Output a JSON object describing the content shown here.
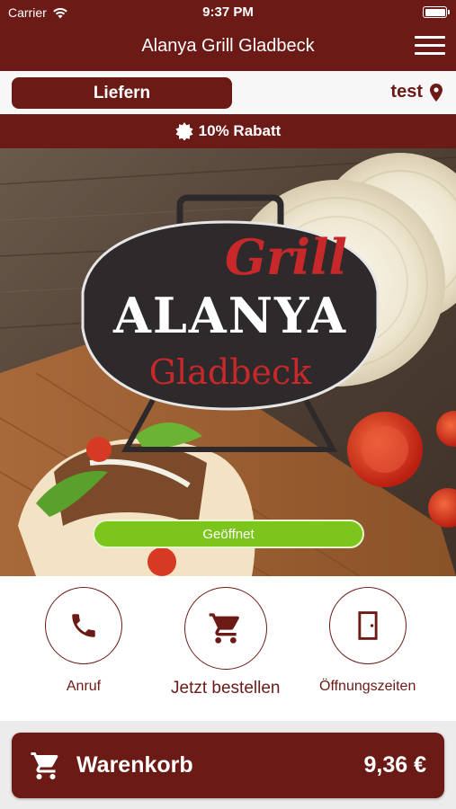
{
  "status_bar": {
    "carrier": "Carrier",
    "time": "9:37 PM"
  },
  "header": {
    "title": "Alanya Grill Gladbeck",
    "menu_icon": "hamburger-menu-icon"
  },
  "mode_bar": {
    "deliver_label": "Liefern",
    "location_label": "test",
    "location_icon": "map-pin-icon"
  },
  "promo": {
    "discount_label": "10% Rabatt",
    "icon": "badge-star-icon"
  },
  "hero": {
    "logo": {
      "script_text": "Grill",
      "name": "ALANYA",
      "city": "Gladbeck"
    },
    "open_status": "Geöffnet"
  },
  "actions": [
    {
      "label": "Anruf",
      "icon": "phone-icon"
    },
    {
      "label": "Jetzt bestellen",
      "icon": "shopping-cart-icon"
    },
    {
      "label": "Öffnungszeiten",
      "icon": "door-icon"
    }
  ],
  "cart": {
    "label": "Warenkorb",
    "total": "9,36 €",
    "icon": "shopping-cart-icon"
  },
  "colors": {
    "brand": "#6b1a16",
    "open_green": "#7cc51d",
    "logo_red": "#c8282a",
    "logo_dark": "#2e2a2b"
  }
}
